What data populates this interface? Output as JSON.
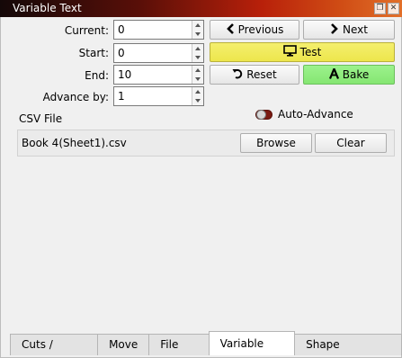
{
  "window": {
    "title": "Variable Text"
  },
  "fields": {
    "current": {
      "label": "Current:",
      "value": "0"
    },
    "start": {
      "label": "Start:",
      "value": "0"
    },
    "end": {
      "label": "End:",
      "value": "10"
    },
    "advance": {
      "label": "Advance by:",
      "value": "1"
    }
  },
  "buttons": {
    "previous": "Previous",
    "next": "Next",
    "test": "Test",
    "reset": "Reset",
    "bake": "Bake",
    "browse": "Browse",
    "clear": "Clear"
  },
  "auto_advance": {
    "label": "Auto-Advance",
    "enabled": false
  },
  "csv": {
    "section_label": "CSV File",
    "file_name": "Book 4(Sheet1).csv"
  },
  "tabs": [
    {
      "label": "Cuts / Layers",
      "active": false
    },
    {
      "label": "Move",
      "active": false
    },
    {
      "label": "File List",
      "active": false
    },
    {
      "label": "Variable Text",
      "active": true
    },
    {
      "label": "Shape Properties",
      "active": false
    }
  ],
  "colors": {
    "test_button": "#efe955",
    "bake_button": "#8ce97a",
    "toggle_track": "#7a1a12"
  },
  "icons": {
    "previous": "chevron-left-icon",
    "next": "chevron-right-icon",
    "test": "monitor-icon",
    "reset": "rotate-ccw-icon",
    "bake": "letter-a-icon"
  }
}
